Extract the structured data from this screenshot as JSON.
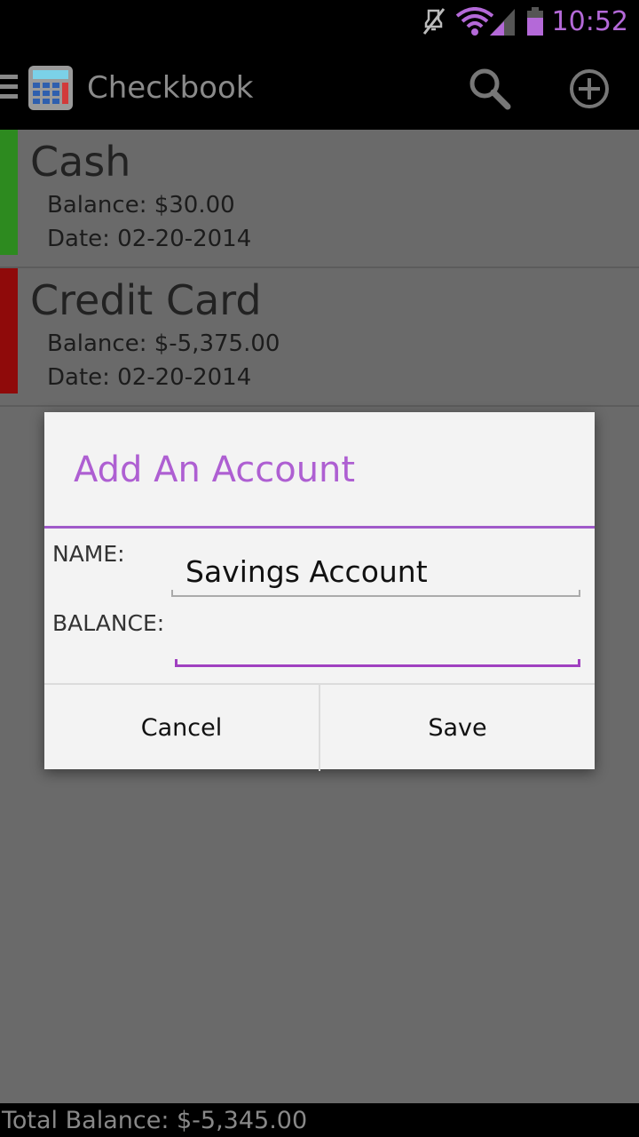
{
  "status_bar": {
    "time": "10:52",
    "icons": [
      "mute-icon",
      "wifi-icon",
      "signal-icon",
      "battery-icon"
    ],
    "accent_color": "#b469d8"
  },
  "action_bar": {
    "title": "Checkbook",
    "icons": [
      "menu-icon",
      "calculator-app-icon",
      "search-icon",
      "add-circle-icon"
    ]
  },
  "accounts": [
    {
      "name": "Cash",
      "balance": "Balance: $30.00",
      "date": "Date: 02-20-2014",
      "color": "#2d8a1f"
    },
    {
      "name": "Credit Card",
      "balance": "Balance: $-5,375.00",
      "date": "Date: 02-20-2014",
      "color": "#8f0a0a"
    }
  ],
  "dialog": {
    "title": "Add An Account",
    "name_label": "NAME:",
    "name_value": "Savings Account",
    "balance_label": "BALANCE:",
    "balance_value": "",
    "cancel_label": "Cancel",
    "save_label": "Save",
    "accent_color": "#a05ac9"
  },
  "footer": {
    "total": "Total Balance: $-5,345.00"
  }
}
